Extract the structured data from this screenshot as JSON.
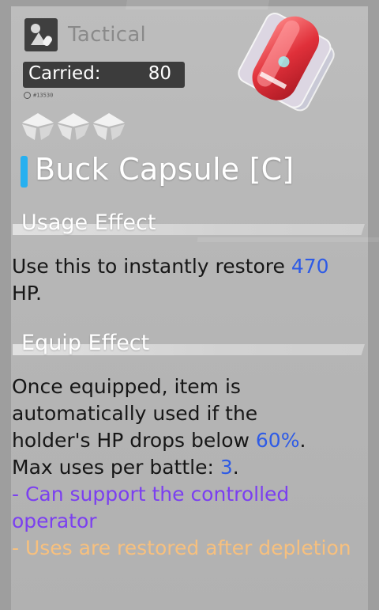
{
  "category": {
    "label": "Tactical",
    "icon": "medic-icon"
  },
  "carried": {
    "label": "Carried:",
    "value": "80"
  },
  "small_tag": "#13530",
  "rarity": {
    "count": 3,
    "icon": "rarity-star-icon"
  },
  "item": {
    "name": "Buck Capsule [C]",
    "art": "red-capsule-pack-image"
  },
  "usage": {
    "title": "Usage Effect",
    "text_before": "Use this to instantly restore ",
    "hp_value": "470",
    "text_after": " HP."
  },
  "equip": {
    "title": "Equip Effect",
    "line1": "Once equipped, item is",
    "line2": "automatically used if the",
    "line3_before": "holder's HP drops below ",
    "threshold": "60%",
    "line3_after": ".",
    "line4_before": "Max uses per battle: ",
    "max_uses": "3",
    "line4_after": ".",
    "bullet1": " - Can support the controlled operator",
    "bullet2": " - Uses are restored after depletion"
  },
  "colors": {
    "name_accent": "#27b0f0",
    "number": "#2e5be6",
    "purple": "#7b3ff0",
    "orange": "#f7c07e"
  }
}
